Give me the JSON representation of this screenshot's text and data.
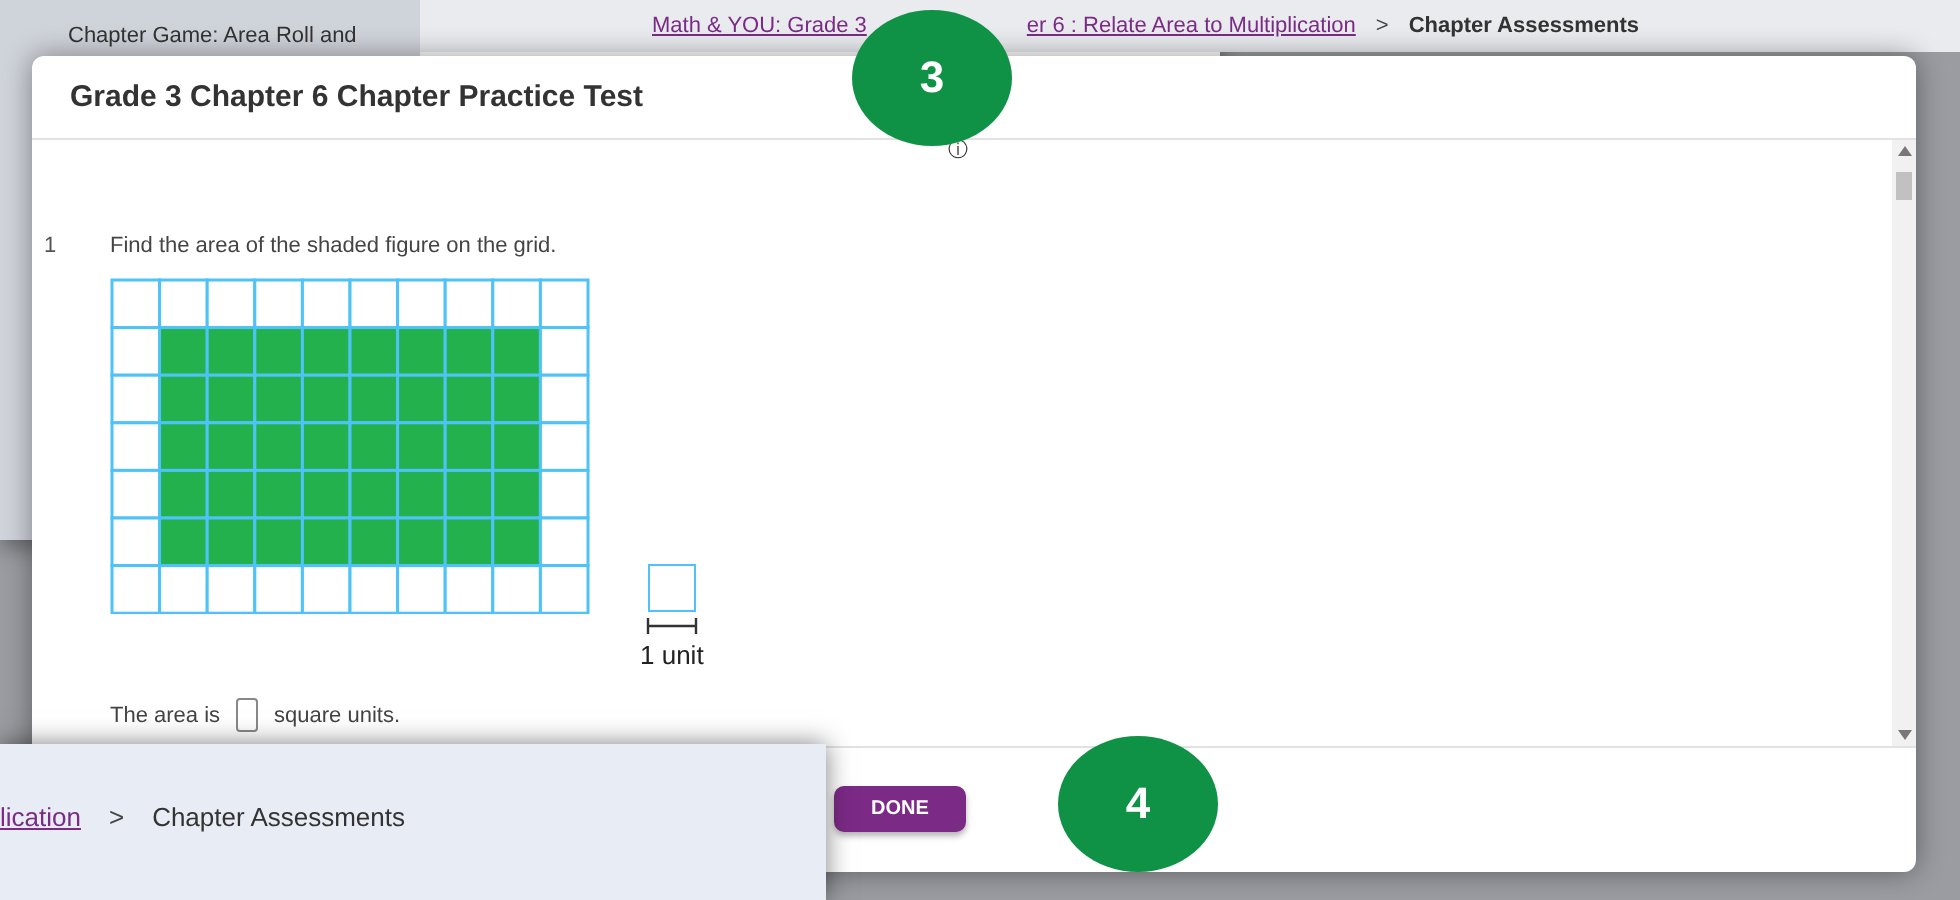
{
  "background_page": {
    "sidebar_item": "Chapter Game: Area Roll and",
    "breadcrumb_fragments": [
      {
        "text": "Math & YOU: Grade 3",
        "kind": "link"
      },
      {
        "text": "er 6 : Relate Area to Multiplication",
        "kind": "link"
      },
      {
        "text": ">",
        "kind": "separator"
      },
      {
        "text": "Chapter Assessments",
        "kind": "current"
      }
    ]
  },
  "dialog": {
    "title": "Grade 3 Chapter 6 Chapter Practice Test",
    "info_icon": "ⓘ",
    "question": {
      "number": "1",
      "prompt": "Find the area of the shaded figure on the grid.",
      "unit_label": "1 unit",
      "answer_before": "The area is",
      "answer_after": "square units."
    },
    "done_button": "DONE"
  },
  "lower_page": {
    "breadcrumb": [
      {
        "text": "lication",
        "kind": "link"
      },
      {
        "text": ">",
        "kind": "separator"
      },
      {
        "text": "Chapter Assessments",
        "kind": "current"
      }
    ]
  },
  "callouts": [
    {
      "label": "3",
      "kind": "top"
    },
    {
      "label": "4",
      "kind": "bottom"
    }
  ]
}
